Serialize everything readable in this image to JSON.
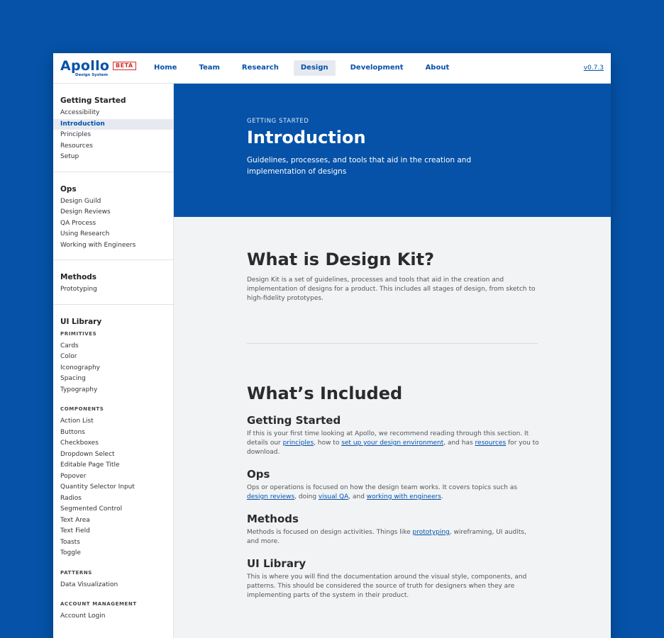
{
  "logo": {
    "name": "Apollo",
    "subtitle": "Design System",
    "badge": "BETA"
  },
  "nav": {
    "items": [
      "Home",
      "Team",
      "Research",
      "Design",
      "Development",
      "About"
    ],
    "active": "Design",
    "version": "v0.7.3"
  },
  "sidebar": {
    "getting_started": {
      "heading": "Getting Started",
      "items": [
        "Accessibility",
        "Introduction",
        "Principles",
        "Resources",
        "Setup"
      ],
      "active": "Introduction"
    },
    "ops": {
      "heading": "Ops",
      "items": [
        "Design Guild",
        "Design Reviews",
        "QA Process",
        "Using Research",
        "Working with Engineers"
      ]
    },
    "methods": {
      "heading": "Methods",
      "items": [
        "Prototyping"
      ]
    },
    "ui_library": {
      "heading": "UI Library",
      "primitives_label": "PRIMITIVES",
      "primitives": [
        "Cards",
        "Color",
        "Iconography",
        "Spacing",
        "Typography"
      ],
      "components_label": "COMPONENTS",
      "components": [
        "Action List",
        "Buttons",
        "Checkboxes",
        "Dropdown Select",
        "Editable Page Title",
        "Popover",
        "Quantity Selector Input",
        "Radios",
        "Segmented Control",
        "Text Area",
        "Text Field",
        "Toasts",
        "Toggle"
      ],
      "patterns_label": "PATTERNS",
      "patterns": [
        "Data Visualization"
      ],
      "account_label": "ACCOUNT MANAGEMENT",
      "account": [
        "Account Login"
      ]
    }
  },
  "hero": {
    "eyebrow": "GETTING STARTED",
    "title": "Introduction",
    "description": "Guidelines, processes, and tools that aid in the creation and implementation of designs"
  },
  "main": {
    "what_is_title": "What is Design Kit?",
    "what_is_body": "Design Kit is a set of guidelines, processes and tools that aid in the creation and implementation of designs for a product. This includes all stages of design, from sketch to high-fidelity prototypes.",
    "included_title": "What’s Included",
    "getting_started": {
      "title": "Getting Started",
      "t1": "If this is your first time looking at Apollo, we recommend reading through this section. It details our ",
      "l1": "principles",
      "t2": ", how to ",
      "l2": "set up your design environment",
      "t3": ", and has ",
      "l3": "resources",
      "t4": " for you to download."
    },
    "ops": {
      "title": "Ops",
      "t1": "Ops or operations is focused on how the design team works. It covers topics such as ",
      "l1": "design reviews",
      "t2": ", doing ",
      "l2": "visual QA",
      "t3": ", and ",
      "l3": "working with engineers",
      "t4": "."
    },
    "methods": {
      "title": "Methods",
      "t1": "Methods is focused on design activities. Things like ",
      "l1": "prototyping",
      "t2": ", wireframing, UI audits, and more."
    },
    "ui_library": {
      "title": "UI Library",
      "body": "This is where you will find the documentation around the visual style, components, and patterns. This should be considered the source of truth for designers when they are implementing parts of the system in their product."
    }
  },
  "colors": {
    "brand": "#0552a8",
    "beta": "#d52b2b",
    "page_bg": "#f1f3f5"
  }
}
